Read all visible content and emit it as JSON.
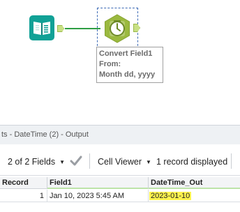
{
  "canvas": {
    "tools": [
      {
        "name": "Input Data",
        "icon": "book-icon"
      },
      {
        "name": "DateTime",
        "icon": "clock-icon"
      }
    ],
    "annotation": {
      "line1": "Convert Field1",
      "line2": "From:",
      "line3": "Month dd, yyyy"
    }
  },
  "results": {
    "title": "ts - DateTime (2) - Output",
    "toolbar": {
      "fields_label": "2 of 2 Fields",
      "viewer_label": "Cell Viewer",
      "records_label": "1 record displayed"
    },
    "columns": [
      "Record",
      "Field1",
      "DateTime_Out"
    ],
    "rows": [
      {
        "record": "1",
        "field1": "Jan 10, 2023 5:45 AM",
        "datetime_out": "2023-01-10"
      }
    ]
  },
  "colors": {
    "tool_teal": "#11a196",
    "datetime_tool": "#9bb93f",
    "connector": "#2e9e44",
    "selection": "#3a68b4",
    "highlight": "#fff44f"
  }
}
